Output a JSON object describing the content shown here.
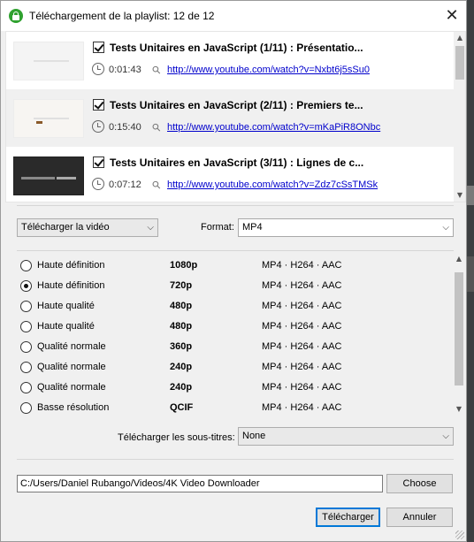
{
  "window": {
    "title": "Téléchargement de la playlist: 12 de 12",
    "close_symbol": "✕"
  },
  "playlist": [
    {
      "title": "Tests Unitaires en JavaScript (1/11) : Présentatio...",
      "duration": "0:01:43",
      "url": "http://www.youtube.com/watch?v=Nxbt6j5sSu0"
    },
    {
      "title": "Tests Unitaires en JavaScript (2/11) : Premiers te...",
      "duration": "0:15:40",
      "url": "http://www.youtube.com/watch?v=mKaPiR8ONbc"
    },
    {
      "title": "Tests Unitaires en JavaScript (3/11) : Lignes de c...",
      "duration": "0:07:12",
      "url": "http://www.youtube.com/watch?v=Zdz7cSsTMSk"
    }
  ],
  "download_type": {
    "selected": "Télécharger la vidéo"
  },
  "format": {
    "label": "Format:",
    "selected": "MP4"
  },
  "quality_options": [
    {
      "quality": "Haute définition",
      "resolution": "1080p",
      "codec": "MP4 · H264 · AAC",
      "selected": false
    },
    {
      "quality": "Haute définition",
      "resolution": "720p",
      "codec": "MP4 · H264 · AAC",
      "selected": true
    },
    {
      "quality": "Haute qualité",
      "resolution": "480p",
      "codec": "MP4 · H264 · AAC",
      "selected": false
    },
    {
      "quality": "Haute qualité",
      "resolution": "480p",
      "codec": "MP4 · H264 · AAC",
      "selected": false
    },
    {
      "quality": "Qualité normale",
      "resolution": "360p",
      "codec": "MP4 · H264 · AAC",
      "selected": false
    },
    {
      "quality": "Qualité normale",
      "resolution": "240p",
      "codec": "MP4 · H264 · AAC",
      "selected": false
    },
    {
      "quality": "Qualité normale",
      "resolution": "240p",
      "codec": "MP4 · H264 · AAC",
      "selected": false
    },
    {
      "quality": "Basse résolution",
      "resolution": "QCIF",
      "codec": "MP4 · H264 · AAC",
      "selected": false
    }
  ],
  "subtitles": {
    "label": "Télécharger les sous-titres:",
    "selected": "None"
  },
  "destination": {
    "path": "C:/Users/Daniel Rubango/Videos/4K Video Downloader",
    "choose_label": "Choose"
  },
  "actions": {
    "download_label": "Télécharger",
    "cancel_label": "Annuler"
  },
  "colors": {
    "accent": "#0078d7",
    "link": "#0000cc",
    "app_icon": "#2fa12f"
  }
}
